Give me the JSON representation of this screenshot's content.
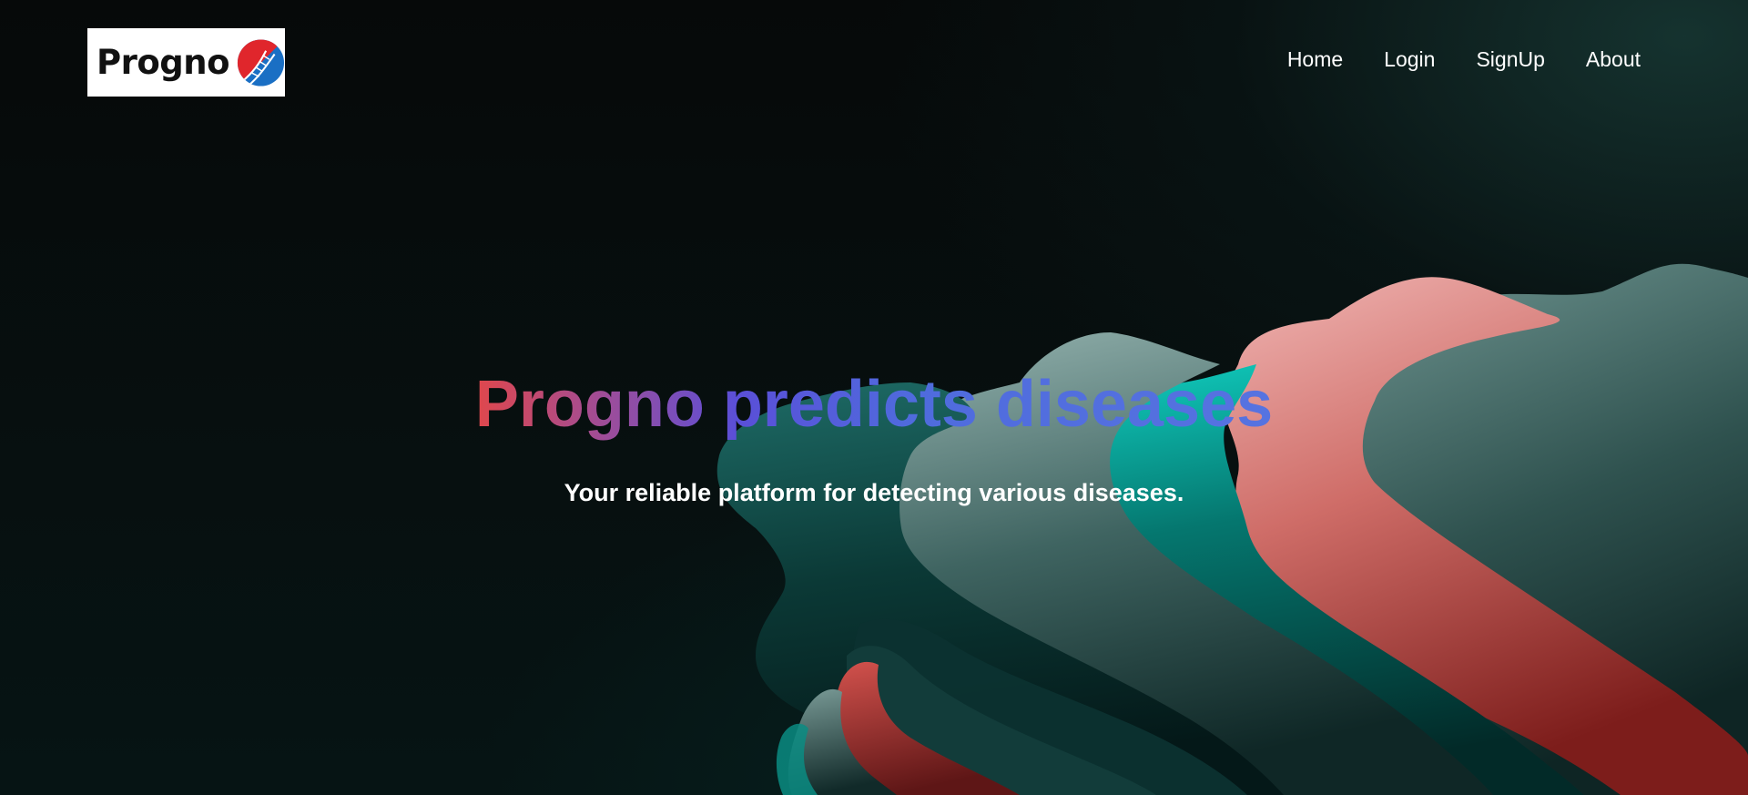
{
  "logo": {
    "text": "Progno",
    "mark_icon": "dna-globe-icon",
    "mark_colors": [
      "#e0262c",
      "#1a6fc4"
    ]
  },
  "nav": {
    "items": [
      {
        "label": "Home"
      },
      {
        "label": "Login"
      },
      {
        "label": "SignUp"
      },
      {
        "label": "About"
      }
    ]
  },
  "hero": {
    "headline": "Progno predicts diseases",
    "tagline": "Your reliable platform for detecting various diseases.",
    "headline_gradient": [
      "#e0474c",
      "#9b4d9c",
      "#5a4fd8",
      "#5673e0"
    ],
    "background_colors": [
      "#050808",
      "#0b3b38",
      "#00a69a",
      "#e39a97",
      "#b84a45",
      "#5d8581"
    ]
  }
}
